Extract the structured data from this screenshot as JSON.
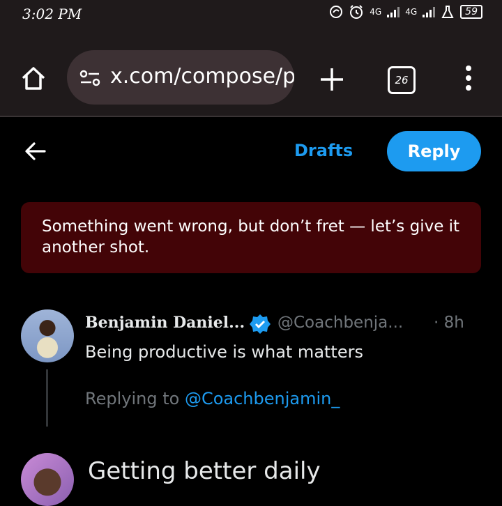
{
  "status_bar": {
    "time": "3:02 PM",
    "network_1": "4G",
    "network_2": "4G",
    "battery": "59",
    "icons": [
      "sync-icon",
      "alarm-icon",
      "signal-icon",
      "signal-icon",
      "flask-icon",
      "battery-icon"
    ]
  },
  "browser": {
    "url": "x.com/compose/p",
    "tab_count": "26",
    "icons": [
      "home-icon",
      "tune-icon",
      "plus-icon",
      "tabs-icon",
      "more-vertical-icon"
    ]
  },
  "compose_header": {
    "drafts_label": "Drafts",
    "reply_label": "Reply"
  },
  "error": {
    "message": "Something went wrong, but don’t fret — let’s give it another shot."
  },
  "tweet": {
    "name": "Benjamin Daniel...",
    "handle": "@Coachbenja...",
    "time": "· 8h",
    "text": "Being productive is what matters",
    "replying_prefix": "Replying to ",
    "replying_handle": "@Coachbenjamin_"
  },
  "compose": {
    "draft_text": "Getting better daily"
  },
  "colors": {
    "accent": "#1d9bf0",
    "error_bg": "#430407",
    "browser_bar": "#1f1a1b",
    "url_pill": "#3d3134"
  }
}
